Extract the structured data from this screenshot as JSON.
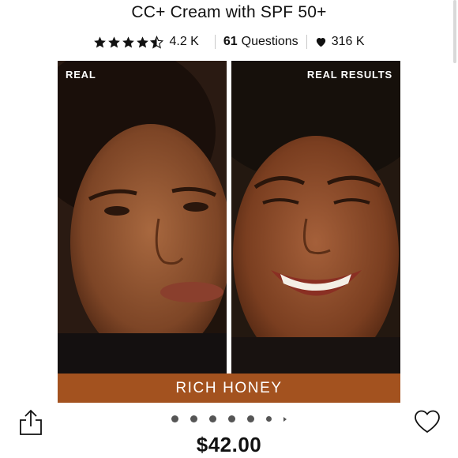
{
  "product": {
    "title": "CC+ Cream with SPF 50+",
    "rating_stars": 4.5,
    "rating_count": "4.2 K",
    "questions_count": "61",
    "questions_label": "Questions",
    "loves_count": "316 K",
    "price": "$42.00"
  },
  "hero": {
    "left_label": "REAL",
    "right_label": "REAL RESULTS",
    "shade_name": "RICH HONEY"
  },
  "carousel": {
    "dot_count": 7,
    "active_index": 0
  },
  "colors": {
    "shade_bar": "#a3521f",
    "text": "#111111",
    "background": "#ffffff"
  },
  "icons": {
    "share": "share-icon",
    "wishlist": "heart-outline-icon",
    "loves": "heart-filled-icon",
    "star": "star-icon"
  }
}
